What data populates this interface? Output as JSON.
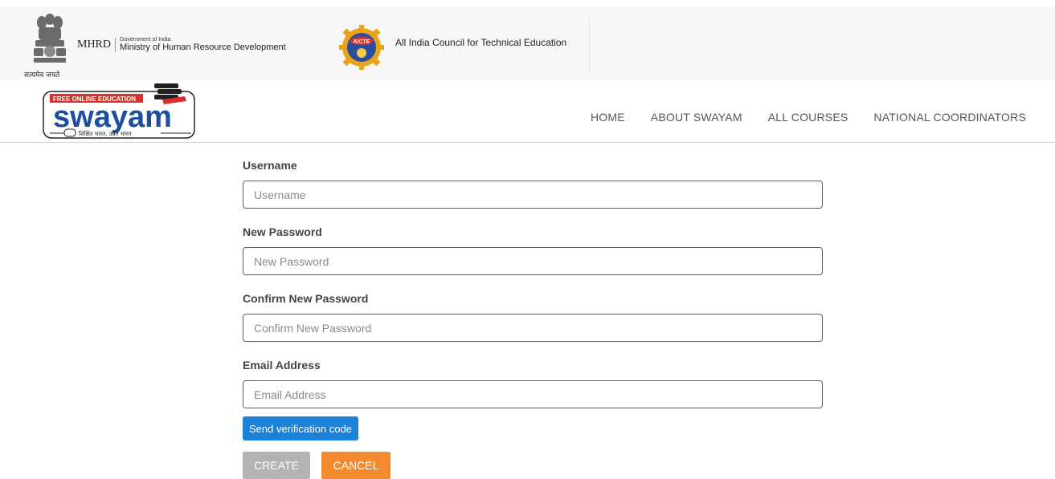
{
  "header": {
    "emblem_motto": "सत्यमेव जयते",
    "mhrd_title": "MHRD",
    "mhrd_gov": "Government of India",
    "mhrd_ministry": "Ministry of Human Resource Development",
    "aicte_logo_text": "AICTE",
    "aicte_name": "All India Council for Technical Education"
  },
  "brand": {
    "tagline": "FREE ONLINE EDUCATION",
    "name": "swayam",
    "subtagline": "शिक्षित भारत, उन्नत भारत"
  },
  "nav": {
    "items": [
      {
        "label": "HOME"
      },
      {
        "label": "ABOUT SWAYAM"
      },
      {
        "label": "ALL COURSES"
      },
      {
        "label": "NATIONAL COORDINATORS"
      }
    ]
  },
  "form": {
    "username": {
      "label": "Username",
      "placeholder": "Username",
      "value": ""
    },
    "new_password": {
      "label": "New Password",
      "placeholder": "New Password",
      "value": ""
    },
    "confirm_password": {
      "label": "Confirm New Password",
      "placeholder": "Confirm New Password",
      "value": ""
    },
    "email": {
      "label": "Email Address",
      "placeholder": "Email Address",
      "value": ""
    },
    "verify_button": "Send verification code",
    "create_button": "CREATE",
    "cancel_button": "CANCEL"
  },
  "colors": {
    "primary_blue": "#1a82d8",
    "cancel_orange": "#f38a2e",
    "create_gray": "#b3b3b3",
    "brand_blue": "#1d4f9c"
  }
}
